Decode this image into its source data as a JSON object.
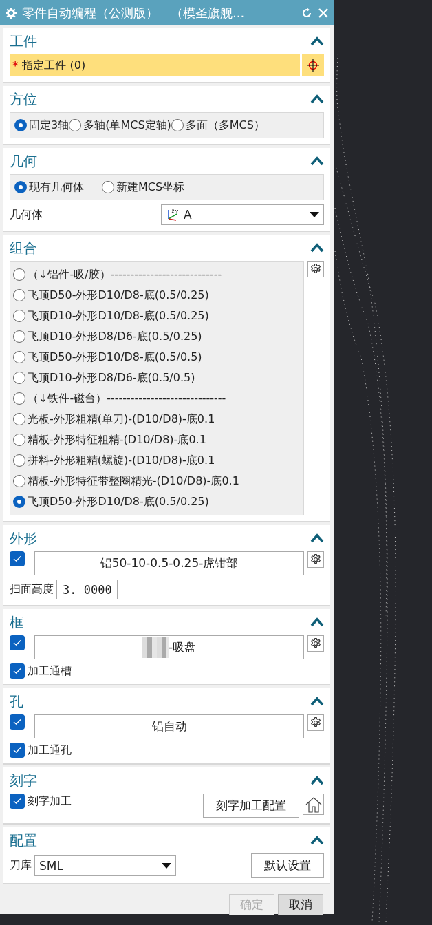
{
  "window": {
    "title": "零件自动编程（公测版）　（模圣旗舰..."
  },
  "workpiece": {
    "title": "工件",
    "expanded": true,
    "required_mark": "*",
    "label": "指定工件 (0)"
  },
  "orientation": {
    "title": "方位",
    "expanded": true,
    "options": [
      {
        "label": "固定3轴",
        "selected": true
      },
      {
        "label": "多轴(单MCS定轴)",
        "selected": false
      },
      {
        "label": "多面（多MCS）",
        "selected": false
      }
    ]
  },
  "geometry": {
    "title": "几何",
    "expanded": true,
    "options": [
      {
        "label": "现有几何体",
        "selected": true
      },
      {
        "label": "新建MCS坐标",
        "selected": false
      }
    ],
    "field_label": "几何体",
    "dropdown_value": "A"
  },
  "combination": {
    "title": "组合",
    "expanded": true,
    "items": [
      {
        "label": "（↓铝件-吸/胶）----------------------------",
        "selected": false
      },
      {
        "label": "飞顶D50-外形D10/D8-底(0.5/0.25)",
        "selected": false
      },
      {
        "label": "飞顶D10-外形D10/D8-底(0.5/0.25)",
        "selected": false
      },
      {
        "label": "飞顶D10-外形D8/D6-底(0.5/0.25)",
        "selected": false
      },
      {
        "label": "飞顶D50-外形D10/D8-底(0.5/0.5)",
        "selected": false
      },
      {
        "label": "飞顶D10-外形D8/D6-底(0.5/0.5)",
        "selected": false
      },
      {
        "label": "（↓铁件-磁台）------------------------------",
        "selected": false
      },
      {
        "label": "光板-外形粗精(单刀)-(D10/D8)-底0.1",
        "selected": false
      },
      {
        "label": "精板-外形特征粗精-(D10/D8)-底0.1",
        "selected": false
      },
      {
        "label": "拼料-外形粗精(螺旋)-(D10/D8)-底0.1",
        "selected": false
      },
      {
        "label": "精板-外形特征带整圈精光-(D10/D8)-底0.1",
        "selected": false
      },
      {
        "label": "飞顶D50-外形D10/D8-底(0.5/0.25)",
        "selected": true
      }
    ]
  },
  "profile": {
    "title": "外形",
    "expanded": true,
    "checked": true,
    "value": "铝50-10-0.5-0.25-虎钳部",
    "height_label": "扫面高度",
    "height_value": "3. 0000"
  },
  "frame": {
    "title": "框",
    "expanded": true,
    "checked": true,
    "value": "-吸盘",
    "option": {
      "label": "加工通槽",
      "checked": true
    }
  },
  "hole": {
    "title": "孔",
    "expanded": true,
    "checked": true,
    "value": "铝自动",
    "option": {
      "label": "加工通孔",
      "checked": true
    }
  },
  "engraving": {
    "title": "刻字",
    "expanded": true,
    "option": {
      "label": "刻字加工",
      "checked": true
    },
    "button": "刻字加工配置"
  },
  "config": {
    "title": "配置",
    "expanded": true,
    "label": "刀库",
    "dropdown_value": "SML",
    "button": "默认设置"
  },
  "footer": {
    "buttons": [
      {
        "label": "确定",
        "disabled": true
      },
      {
        "label": "取消",
        "disabled": false
      }
    ]
  }
}
